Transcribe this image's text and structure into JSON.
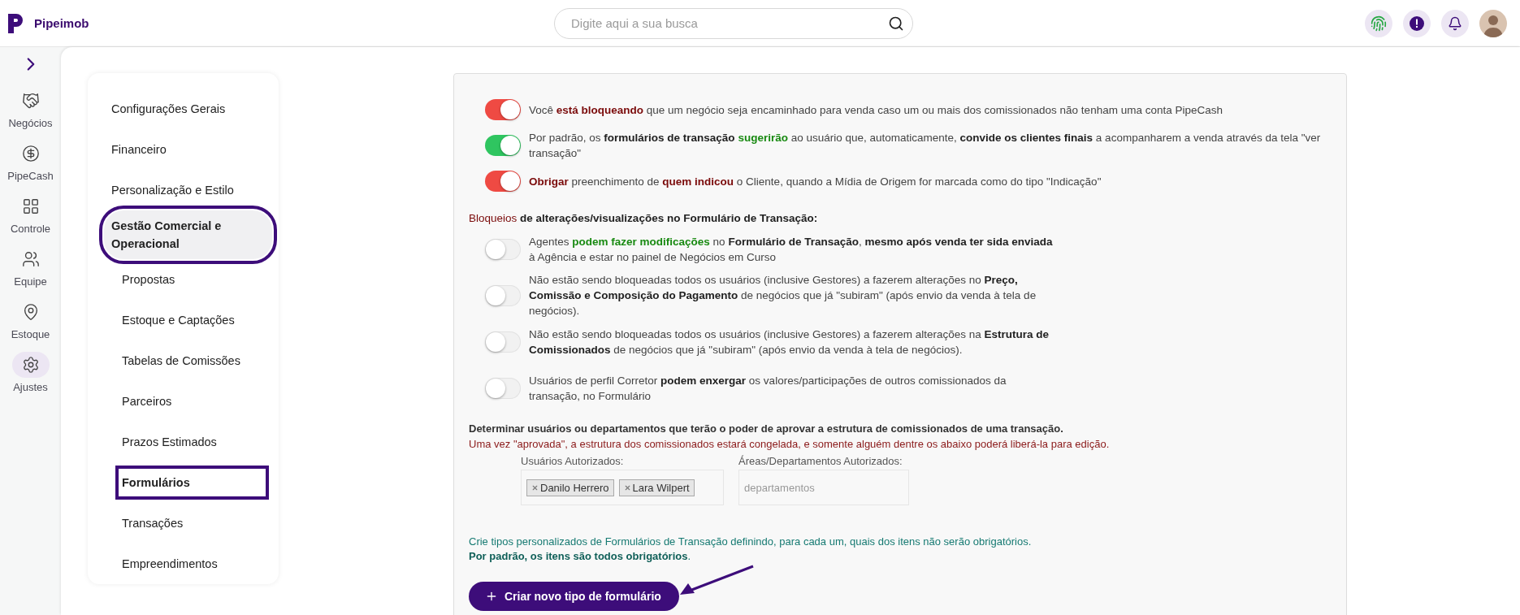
{
  "header": {
    "brand": "Pipeimob",
    "search": {
      "placeholder": "Digite aqui a sua busca"
    }
  },
  "nav": {
    "items": [
      {
        "label": "Negócios",
        "selected": false
      },
      {
        "label": "PipeCash",
        "selected": false
      },
      {
        "label": "Controle",
        "selected": false
      },
      {
        "label": "Equipe",
        "selected": false
      },
      {
        "label": "Estoque",
        "selected": false
      },
      {
        "label": "Ajustes",
        "selected": true
      }
    ]
  },
  "settings_menu": {
    "items": [
      {
        "label": "Configurações Gerais",
        "selected": false,
        "annotated": false
      },
      {
        "label": "Financeiro",
        "selected": false,
        "annotated": false
      },
      {
        "label": "Personalização e Estilo",
        "selected": false,
        "annotated": false
      },
      {
        "label": "Gestão Comercial e Operacional",
        "selected": true,
        "annotated": true,
        "children": [
          {
            "label": "Propostas",
            "selected": false,
            "annotated": false
          },
          {
            "label": "Estoque e Captações",
            "selected": false,
            "annotated": false
          },
          {
            "label": "Tabelas de Comissões",
            "selected": false,
            "annotated": false
          },
          {
            "label": "Parceiros",
            "selected": false,
            "annotated": false
          },
          {
            "label": "Prazos Estimados",
            "selected": false,
            "annotated": false
          },
          {
            "label": "Formulários",
            "selected": true,
            "annotated": true
          },
          {
            "label": "Transações",
            "selected": false,
            "annotated": false
          },
          {
            "label": "Empreendimentos",
            "selected": false,
            "annotated": false
          }
        ]
      }
    ]
  },
  "toggles": [
    {
      "on": true,
      "color": "#ef4a43",
      "parts": [
        {
          "kind": "plain",
          "text": "Você "
        },
        {
          "kind": "bold-red",
          "text": "está bloqueando"
        },
        {
          "kind": "plain",
          "text": " que um negócio seja encaminhado para venda caso um ou mais dos comissionados não tenham uma conta PipeCash"
        }
      ]
    },
    {
      "on": true,
      "color": "#2fc560",
      "parts": [
        {
          "kind": "plain",
          "text": "Por padrão, os "
        },
        {
          "kind": "bold",
          "text": "formulários de transação "
        },
        {
          "kind": "bold-green",
          "text": "sugerirão"
        },
        {
          "kind": "plain",
          "text": " ao usuário que, automaticamente, "
        },
        {
          "kind": "bold",
          "text": "convide os clientes finais"
        },
        {
          "kind": "plain",
          "text": " a acompanharem a venda através da tela \"ver transação\""
        }
      ]
    },
    {
      "on": true,
      "color": "#ef4a43",
      "parts": [
        {
          "kind": "bold-red",
          "text": "Obrigar"
        },
        {
          "kind": "plain",
          "text": " preenchimento de "
        },
        {
          "kind": "bold-red",
          "text": "quem indicou"
        },
        {
          "kind": "plain",
          "text": " o Cliente, quando a Mídia de Origem for marcada como do tipo \"Indicação\""
        }
      ]
    }
  ],
  "blocks": {
    "title": [
      {
        "kind": "red",
        "text": "Bloqueios"
      },
      {
        "kind": "bold",
        "text": " de alterações/visualizações no Formulário de Transação:"
      }
    ],
    "toggles": [
      {
        "on": false,
        "parts": [
          {
            "kind": "plain",
            "text": "Agentes "
          },
          {
            "kind": "bold-green",
            "text": "podem fazer modificações"
          },
          {
            "kind": "plain",
            "text": " no "
          },
          {
            "kind": "bold",
            "text": "Formulário de Transação"
          },
          {
            "kind": "plain",
            "text": ", "
          },
          {
            "kind": "bold",
            "text": "mesmo após venda ter sida enviada"
          },
          {
            "kind": "plain",
            "text": " à Agência e estar no painel de Negócios em Curso"
          }
        ]
      },
      {
        "on": false,
        "parts": [
          {
            "kind": "plain",
            "text": "Não estão sendo bloqueadas todos os usuários (inclusive Gestores) a fazerem alterações no "
          },
          {
            "kind": "bold",
            "text": "Preço, Comissão e Composição do Pagamento"
          },
          {
            "kind": "plain",
            "text": " de negócios que já \"subiram\" (após envio da venda à tela de negócios)."
          }
        ]
      },
      {
        "on": false,
        "parts": [
          {
            "kind": "plain",
            "text": "Não estão sendo bloqueadas todos os usuários (inclusive Gestores) a fazerem alterações na "
          },
          {
            "kind": "bold",
            "text": "Estrutura de Comissionados"
          },
          {
            "kind": "plain",
            "text": " de negócios que já \"subiram\" (após envio da venda à tela de negócios)."
          }
        ]
      },
      {
        "on": false,
        "parts": [
          {
            "kind": "plain",
            "text": "Usuários de perfil Corretor "
          },
          {
            "kind": "bold",
            "text": "podem enxergar"
          },
          {
            "kind": "plain",
            "text": " os valores/participações de outros comissionados da transação, no Formulário"
          }
        ]
      }
    ]
  },
  "approval": {
    "title": "Determinar usuários ou departamentos que terão o poder de aprovar a estrutura de comissionados de uma transação.",
    "note": "Uma vez \"aprovada\", a estrutura dos comissionados estará congelada, e somente alguém dentre os abaixo poderá liberá-la para edição.",
    "users": {
      "label": "Usuários Autorizados:",
      "chips": [
        "Danilo Herrero",
        "Lara Wilpert"
      ]
    },
    "departments": {
      "label": "Áreas/Departamentos Autorizados:",
      "placeholder": "departamentos"
    }
  },
  "forms": {
    "info": "Crie tipos personalizados de Formulários de Transação definindo, para cada um, quais dos itens não serão obrigatórios.",
    "info_bold": "Por padrão, os itens são todos obrigatórios",
    "info_end": ".",
    "button": {
      "label": "Criar novo tipo de formulário",
      "annotated": true
    }
  }
}
